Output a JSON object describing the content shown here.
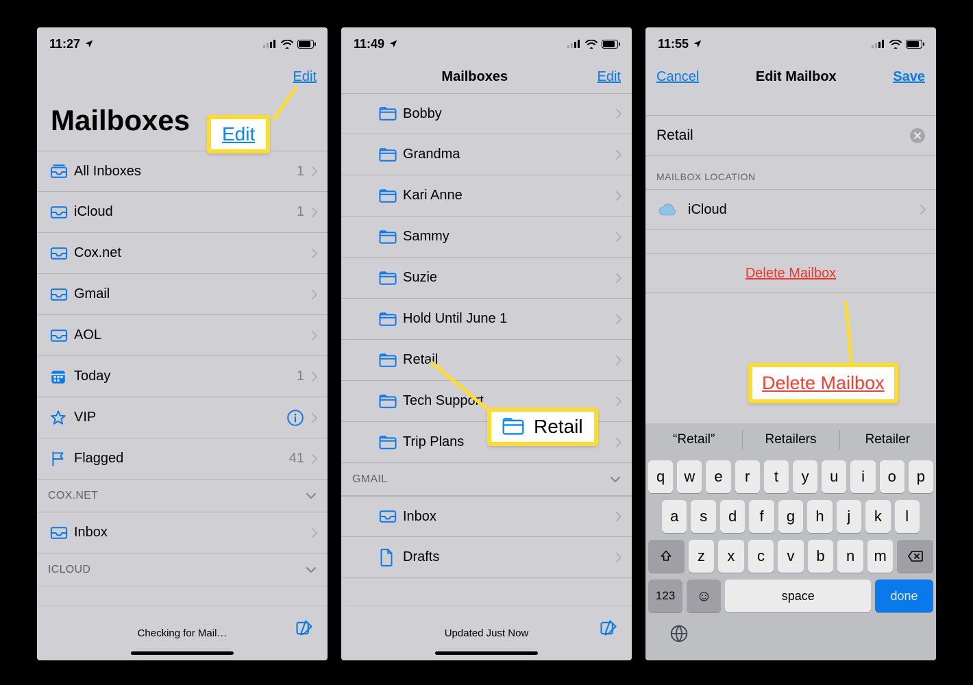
{
  "colors": {
    "accent": "#0a84ff",
    "destructive": "#ff3b30",
    "highlight": "#fcdd2f"
  },
  "p1": {
    "time": "11:27",
    "nav": {
      "edit": "Edit",
      "title": "Mailboxes"
    },
    "rows": [
      {
        "type": "inbox-combined",
        "label": "All Inboxes",
        "count": "1"
      },
      {
        "type": "inbox",
        "label": "iCloud",
        "count": "1"
      },
      {
        "type": "inbox",
        "label": "Cox.net"
      },
      {
        "type": "inbox",
        "label": "Gmail"
      },
      {
        "type": "inbox",
        "label": "AOL"
      },
      {
        "type": "today",
        "label": "Today",
        "count": "1"
      },
      {
        "type": "vip",
        "label": "VIP",
        "info": true
      },
      {
        "type": "flag",
        "label": "Flagged",
        "count": "41"
      }
    ],
    "sections": [
      {
        "header": "COX.NET",
        "rows": [
          {
            "type": "inbox",
            "label": "Inbox"
          }
        ]
      },
      {
        "header": "ICLOUD"
      }
    ],
    "status": "Checking for Mail…",
    "callout": "Edit"
  },
  "p2": {
    "time": "11:49",
    "nav": {
      "edit": "Edit",
      "title": "Mailboxes"
    },
    "rows": [
      {
        "label": "Bobby"
      },
      {
        "label": "Grandma"
      },
      {
        "label": "Kari Anne"
      },
      {
        "label": "Sammy"
      },
      {
        "label": "Suzie"
      },
      {
        "label": "Hold Until June 1"
      },
      {
        "label": "Retail"
      },
      {
        "label": "Tech Support"
      },
      {
        "label": "Trip Plans"
      }
    ],
    "section_gmail": {
      "header": "GMAIL",
      "rows": [
        {
          "type": "inbox",
          "label": "Inbox"
        },
        {
          "type": "doc",
          "label": "Drafts"
        }
      ]
    },
    "status": "Updated Just Now",
    "callout": "Retail"
  },
  "p3": {
    "time": "11:55",
    "nav": {
      "cancel": "Cancel",
      "title": "Edit Mailbox",
      "save": "Save"
    },
    "name_value": "Retail",
    "location_header": "MAILBOX LOCATION",
    "location_value": "iCloud",
    "delete_label": "Delete Mailbox",
    "suggestions": [
      "“Retail”",
      "Retailers",
      "Retailer"
    ],
    "keyboard": {
      "r1": [
        "q",
        "w",
        "e",
        "r",
        "t",
        "y",
        "u",
        "i",
        "o",
        "p"
      ],
      "r2": [
        "a",
        "s",
        "d",
        "f",
        "g",
        "h",
        "j",
        "k",
        "l"
      ],
      "r3": [
        "z",
        "x",
        "c",
        "v",
        "b",
        "n",
        "m"
      ],
      "k123": "123",
      "space": "space",
      "done": "done"
    },
    "callout": "Delete Mailbox"
  }
}
